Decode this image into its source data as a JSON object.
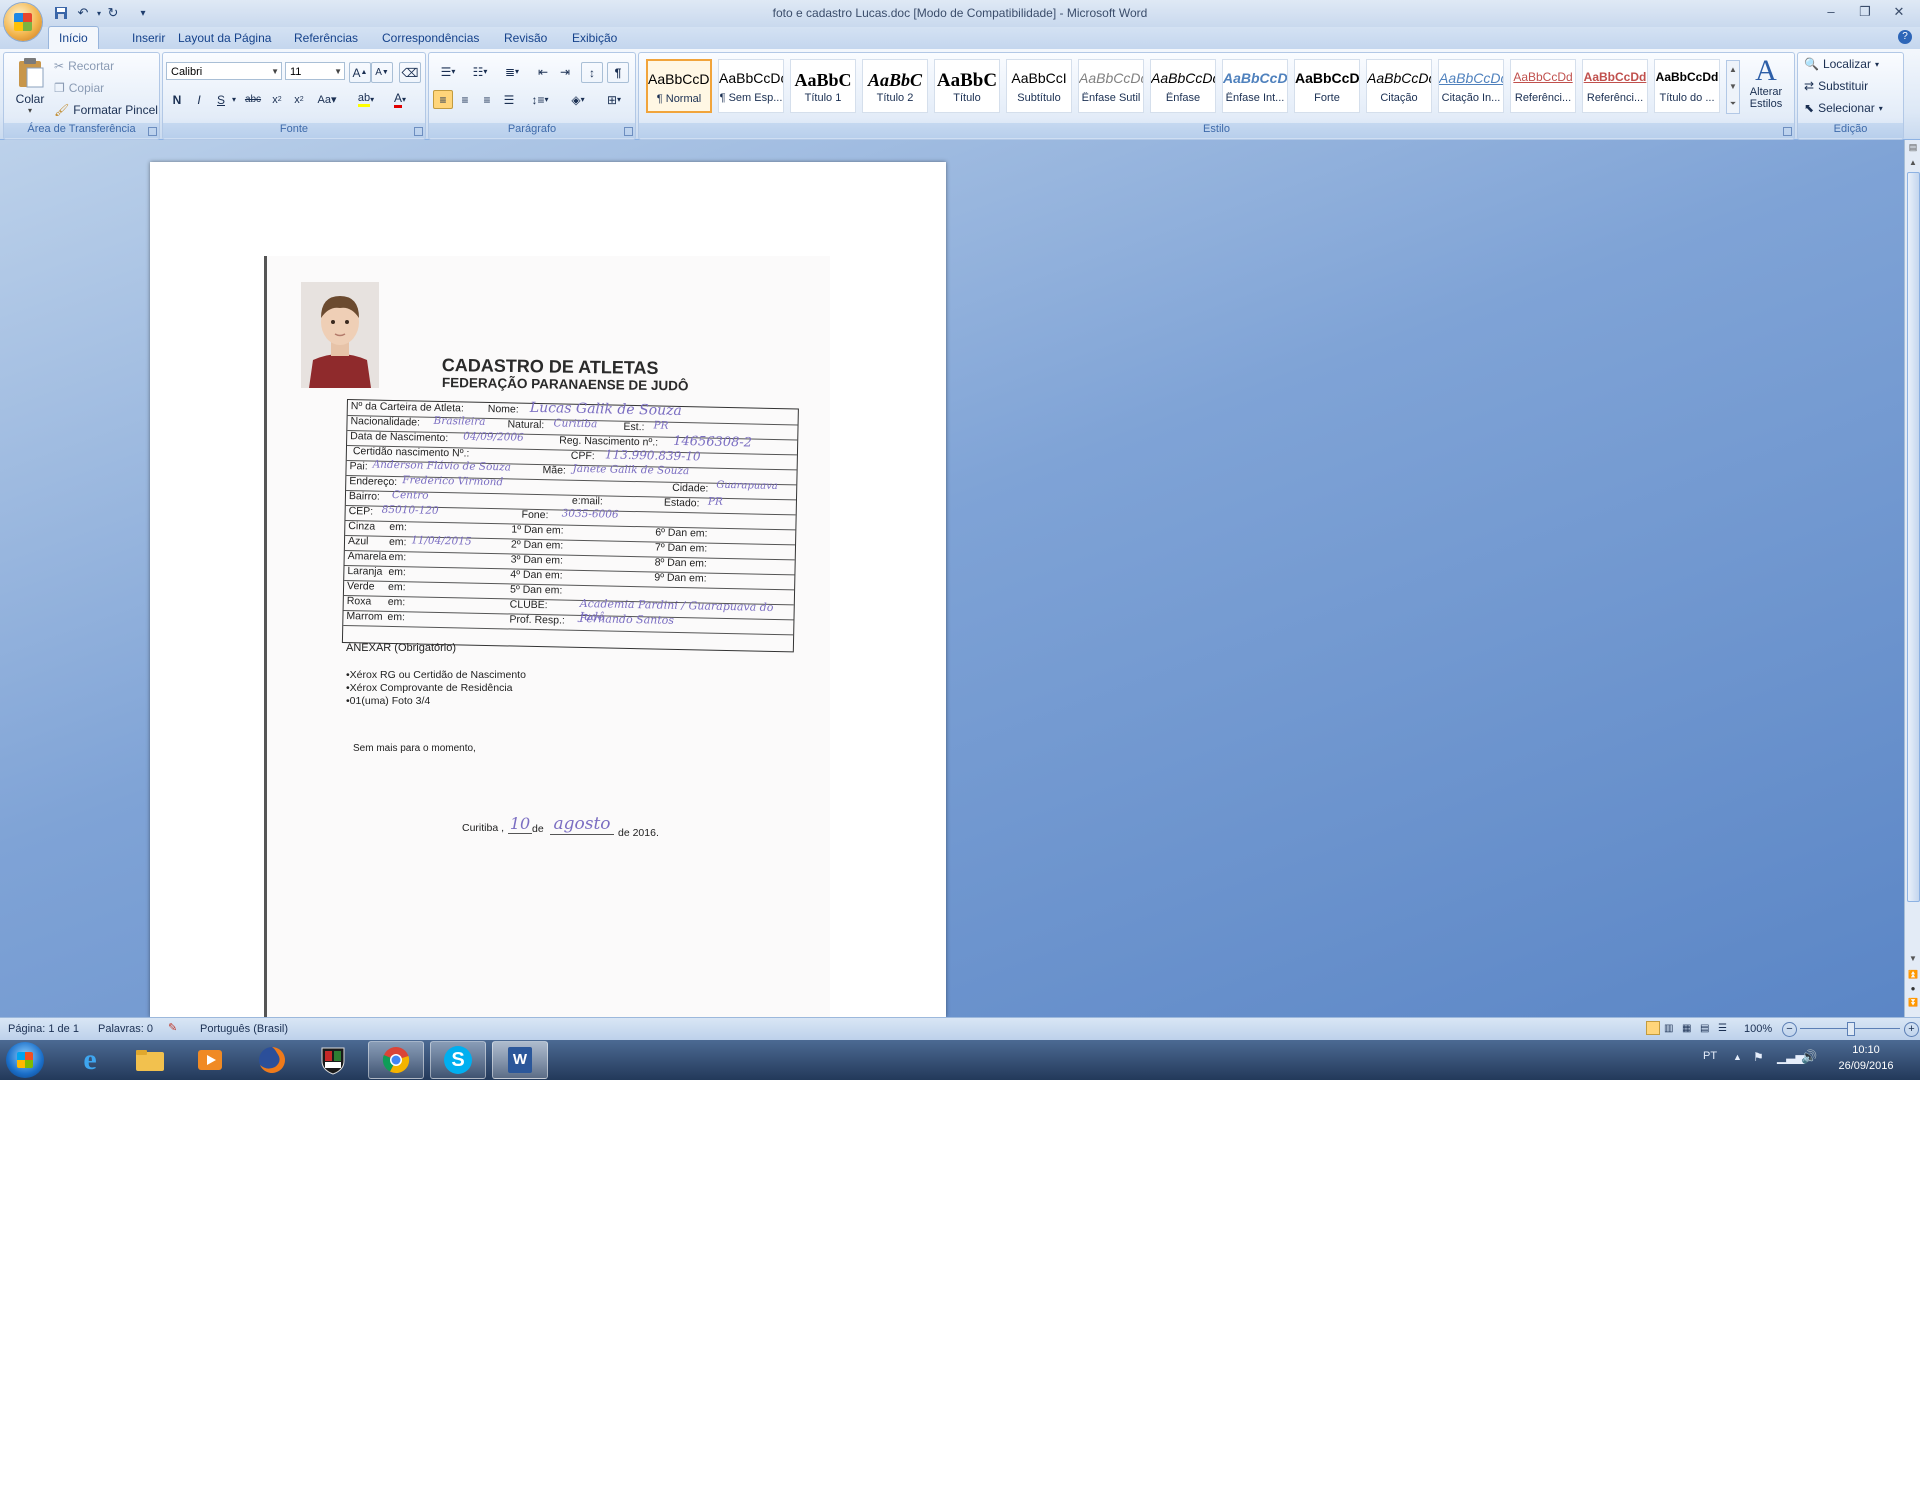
{
  "window": {
    "title": "foto e cadastro Lucas.doc [Modo de Compatibilidade] - Microsoft Word",
    "controls": {
      "minimize": "–",
      "restore": "❐",
      "close": "✕"
    }
  },
  "quick_access": {
    "save_icon": "save-icon",
    "undo_icon": "undo-icon",
    "redo_icon": "redo-icon",
    "customize": "▾"
  },
  "tabs": [
    "Início",
    "Inserir",
    "Layout da Página",
    "Referências",
    "Correspondências",
    "Revisão",
    "Exibição"
  ],
  "ribbon": {
    "clipboard": {
      "paste": "Colar",
      "cut": "Recortar",
      "copy": "Copiar",
      "format_painter": "Formatar Pincel",
      "label": "Área de Transferência"
    },
    "font": {
      "family": "Calibri",
      "size": "11",
      "label": "Fonte"
    },
    "paragraph": {
      "label": "Parágrafo"
    },
    "styles": {
      "label": "Estilo",
      "items": [
        {
          "sample": "AaBbCcDc",
          "name": "¶ Normal"
        },
        {
          "sample": "AaBbCcDc",
          "name": "¶ Sem Esp..."
        },
        {
          "sample": "AaBbC",
          "name": "Título 1"
        },
        {
          "sample": "AaBbC",
          "name": "Título 2"
        },
        {
          "sample": "AaBbC",
          "name": "Título"
        },
        {
          "sample": "AaBbCcI",
          "name": "Subtítulo"
        },
        {
          "sample": "AaBbCcDc",
          "name": "Ênfase Sutil"
        },
        {
          "sample": "AaBbCcDc",
          "name": "Ênfase"
        },
        {
          "sample": "AaBbCcDc",
          "name": "Ênfase Int..."
        },
        {
          "sample": "AaBbCcDc",
          "name": "Forte"
        },
        {
          "sample": "AaBbCcDc",
          "name": "Citação"
        },
        {
          "sample": "AaBbCcDc",
          "name": "Citação In..."
        },
        {
          "sample": "AaBbCcDd",
          "name": "Referênci..."
        },
        {
          "sample": "AaBbCcDd",
          "name": "Referênci..."
        },
        {
          "sample": "AaBbCcDd",
          "name": "Título do ..."
        }
      ],
      "change_styles": "Alterar Estilos"
    },
    "editing": {
      "find": "Localizar",
      "replace": "Substituir",
      "select": "Selecionar",
      "label": "Edição"
    }
  },
  "document": {
    "heading1": "CADASTRO DE ATLETAS",
    "heading2": "FEDERAÇÃO PARANAENSE DE JUDÔ",
    "form": {
      "r1": {
        "l1": "Nº da Carteira de Atleta:",
        "l2": "Nome:",
        "h": "Lucas Galik de Souza"
      },
      "r2": {
        "l1": "Nacionalidade:",
        "h1": "Brasileira",
        "l2": "Natural:",
        "h2": "Curitiba",
        "l3": "Est.:",
        "h3": "PR"
      },
      "r3": {
        "l1": "Data de Nascimento:",
        "h1": "04/09/2006",
        "l2": "Reg. Nascimento nº.:",
        "h2": "14656308-2"
      },
      "r4": {
        "l1": "Certidão nascimento Nº.:",
        "l2": "CPF:",
        "h2": "113.990.839-10"
      },
      "r5": {
        "l1": "Pai:",
        "h1": "Anderson Flávio de Souza",
        "l2": "Mãe:",
        "h2": "Janete Galik de Souza"
      },
      "r6": {
        "l1": "Endereço:",
        "h1": "Frederico Virmond",
        "l2": "Cidade:",
        "h2": "Guarapuava"
      },
      "r7": {
        "l1": "Bairro:",
        "h1": "Centro",
        "l2": "e:mail:",
        "l3": "Estado:",
        "h3": "PR"
      },
      "r8": {
        "l1": "CEP:",
        "h1": "85010-120",
        "l2": "Fone:",
        "h2": "3035-6006"
      },
      "belts": [
        {
          "belt": "Cinza",
          "em": "em:",
          "date": "",
          "dan": "1º Dan em:",
          "dan2": "6º Dan em:"
        },
        {
          "belt": "Azul",
          "em": "em:",
          "date": "11/04/2015",
          "dan": "2º Dan em:",
          "dan2": "7º Dan em:"
        },
        {
          "belt": "Amarela",
          "em": "em:",
          "date": "",
          "dan": "3º Dan em:",
          "dan2": "8º Dan em:"
        },
        {
          "belt": "Laranja",
          "em": "em:",
          "date": "",
          "dan": "4º Dan em:",
          "dan2": "9º Dan em:"
        },
        {
          "belt": "Verde",
          "em": "em:",
          "date": "",
          "dan": "5º Dan em:",
          "dan2": ""
        },
        {
          "belt": "Roxa",
          "em": "em:",
          "date": "",
          "dan": "CLUBE:",
          "dan2": "Academia Pardini / Guarapuava do Judô"
        },
        {
          "belt": "Marrom",
          "em": "em:",
          "date": "",
          "dan": "Prof. Resp.:",
          "dan2": "Fernando Santos"
        }
      ]
    },
    "annex_title": "ANEXAR (Obrigatório)",
    "annex_items": [
      "•Xérox RG ou Certidão de Nascimento",
      "•Xérox Comprovante de Residência",
      "•01(uma) Foto 3/4"
    ],
    "closing": "Sem mais para o momento,",
    "date_line": {
      "city": "Curitiba ,",
      "day": "10",
      "de1": "de",
      "month": "agosto",
      "year": "de 2016."
    }
  },
  "statusbar": {
    "page": "Página: 1 de 1",
    "words": "Palavras: 0",
    "language": "Português (Brasil)",
    "zoom": "100%",
    "zoom_fraction": 0.5
  },
  "taskbar": {
    "apps": [
      "start-orb",
      "internet-explorer-icon",
      "file-explorer-icon",
      "media-player-icon",
      "firefox-icon",
      "shield-app-icon",
      "chrome-icon",
      "skype-icon",
      "word-icon"
    ],
    "lang": "PT",
    "time": "10:10",
    "date": "26/09/2016"
  }
}
